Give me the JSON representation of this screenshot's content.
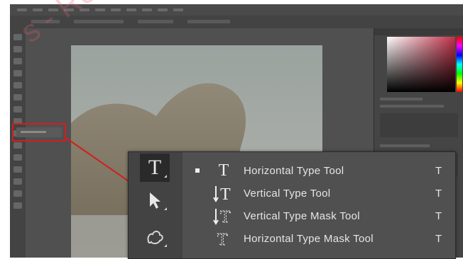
{
  "app": {
    "watermark": "s - Rev"
  },
  "flyout": {
    "items": [
      {
        "label": "Horizontal Type Tool",
        "shortcut": "T",
        "icon": "T",
        "selected": true
      },
      {
        "label": "Vertical Type Tool",
        "shortcut": "T",
        "icon": "↕T",
        "selected": false
      },
      {
        "label": "Vertical Type Mask Tool",
        "shortcut": "T",
        "icon": "↕T",
        "selected": false
      },
      {
        "label": "Horizontal Type Mask Tool",
        "shortcut": "T",
        "icon": "T",
        "selected": false
      }
    ]
  },
  "toolbar": {
    "type_tool_glyph": "T",
    "move_tool_glyph": "▲"
  },
  "colors": {
    "highlight": "#d21e1e",
    "panel_bg": "#505050",
    "toolbar_bg": "#434343"
  }
}
